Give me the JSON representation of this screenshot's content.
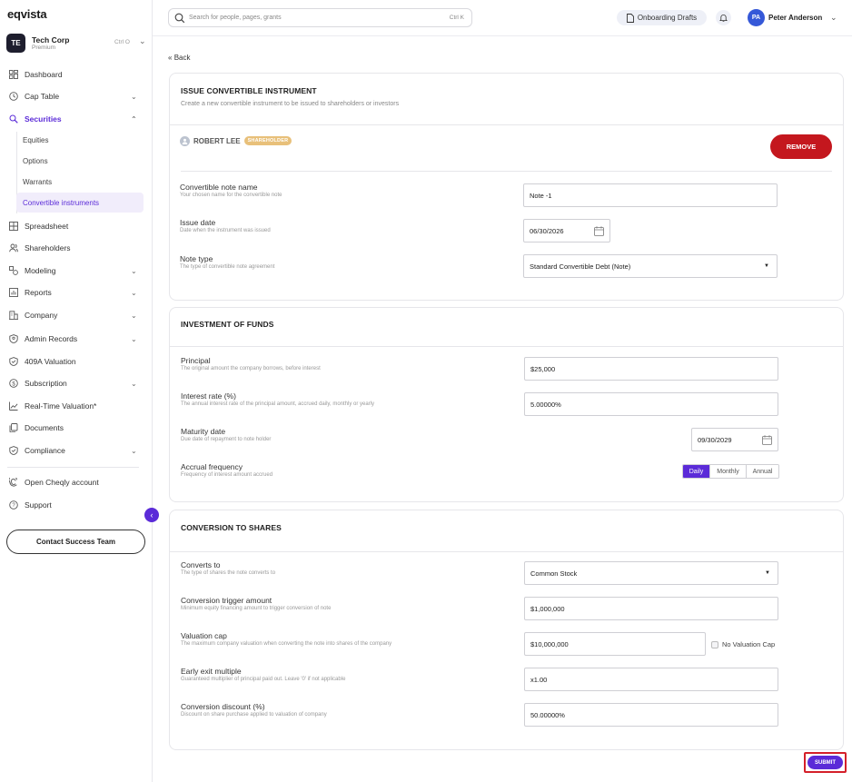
{
  "app": {
    "logo": "eqvista"
  },
  "org": {
    "initials": "TE",
    "name": "Tech Corp",
    "plan": "Premium",
    "shortcut": "Ctrl O"
  },
  "sidebar": {
    "items": [
      {
        "label": "Dashboard",
        "icon": "dashboard-icon"
      },
      {
        "label": "Cap Table",
        "icon": "clock-icon",
        "chevron": "down"
      },
      {
        "label": "Securities",
        "icon": "securities-icon",
        "chevron": "up",
        "active": true
      },
      {
        "label": "Spreadsheet",
        "icon": "spreadsheet-icon"
      },
      {
        "label": "Shareholders",
        "icon": "users-icon"
      },
      {
        "label": "Modeling",
        "icon": "modeling-icon",
        "chevron": "down"
      },
      {
        "label": "Reports",
        "icon": "reports-icon",
        "chevron": "down"
      },
      {
        "label": "Company",
        "icon": "company-icon",
        "chevron": "down"
      },
      {
        "label": "Admin Records",
        "icon": "admin-records-icon",
        "chevron": "down"
      },
      {
        "label": "409A Valuation",
        "icon": "shield-check-icon"
      },
      {
        "label": "Subscription",
        "icon": "dollar-icon",
        "chevron": "down"
      },
      {
        "label": "Real-Time Valuation*",
        "icon": "trend-icon"
      },
      {
        "label": "Documents",
        "icon": "documents-icon"
      },
      {
        "label": "Compliance",
        "icon": "compliance-icon",
        "chevron": "down"
      },
      {
        "label": "Open Cheqly account",
        "icon": "cheqly-icon"
      },
      {
        "label": "Support",
        "icon": "help-icon"
      }
    ],
    "securities_sub": [
      "Equities",
      "Options",
      "Warrants",
      "Convertible instruments"
    ],
    "active_sub": "Convertible instruments",
    "contact_button": "Contact Success Team"
  },
  "topbar": {
    "search_placeholder": "Search for people, pages, grants",
    "search_shortcut": "Ctrl K",
    "drafts_label": "Onboarding Drafts",
    "user_initials": "PA",
    "user_name": "Peter Anderson"
  },
  "back_label": "Back",
  "issue": {
    "title": "ISSUE CONVERTIBLE INSTRUMENT",
    "subtitle": "Create a new convertible instrument to be issued to shareholders or investors",
    "holder_name": "ROBERT LEE",
    "holder_badge": "SHAREHOLDER",
    "remove_label": "REMOVE",
    "fields": {
      "name": {
        "label": "Convertible note name",
        "help": "Your chosen name for the convertible note",
        "value": "Note -1"
      },
      "issue_date": {
        "label": "Issue date",
        "help": "Date when the instrument was issued",
        "value": "06/30/2026"
      },
      "note_type": {
        "label": "Note type",
        "help": "The type of convertible note agreement",
        "value": "Standard Convertible Debt (Note)"
      }
    }
  },
  "investment": {
    "title": "INVESTMENT OF FUNDS",
    "fields": {
      "principal": {
        "label": "Principal",
        "help": "The original amount the company borrows, before interest",
        "value": "$25,000"
      },
      "interest": {
        "label": "Interest rate (%)",
        "help": "The annual interest rate of the principal amount, accrued daily, monthly or yearly",
        "value": "5.00000%"
      },
      "maturity": {
        "label": "Maturity date",
        "help": "Due date of repayment to note holder",
        "value": "09/30/2029"
      },
      "accrual": {
        "label": "Accrual frequency",
        "help": "Frequency of interest amount accrued",
        "options": [
          "Daily",
          "Monthly",
          "Annual"
        ],
        "selected": "Daily"
      }
    }
  },
  "conversion": {
    "title": "CONVERSION TO SHARES",
    "fields": {
      "converts_to": {
        "label": "Converts to",
        "help": "The type of shares the note converts to",
        "value": "Common Stock"
      },
      "trigger": {
        "label": "Conversion trigger amount",
        "help": "Minimum equity financing amount to trigger conversion of note",
        "value": "$1,000,000"
      },
      "cap": {
        "label": "Valuation cap",
        "help": "The maximum company valuation when converting the note into shares of the company",
        "value": "$10,000,000",
        "no_cap_label": "No Valuation Cap",
        "no_cap_checked": false
      },
      "exit": {
        "label": "Early exit multiple",
        "help": "Guaranteed multiplier of principal paid out. Leave '0' if not applicable",
        "value": "x1.00"
      },
      "discount": {
        "label": "Conversion discount (%)",
        "help": "Discount on share purchase applied to valuation of company",
        "value": "50.00000%"
      }
    }
  },
  "submit_label": "SUBMIT",
  "colors": {
    "accent": "#5b2bd8",
    "danger": "#c4171e",
    "badge": "#e8c07a"
  }
}
